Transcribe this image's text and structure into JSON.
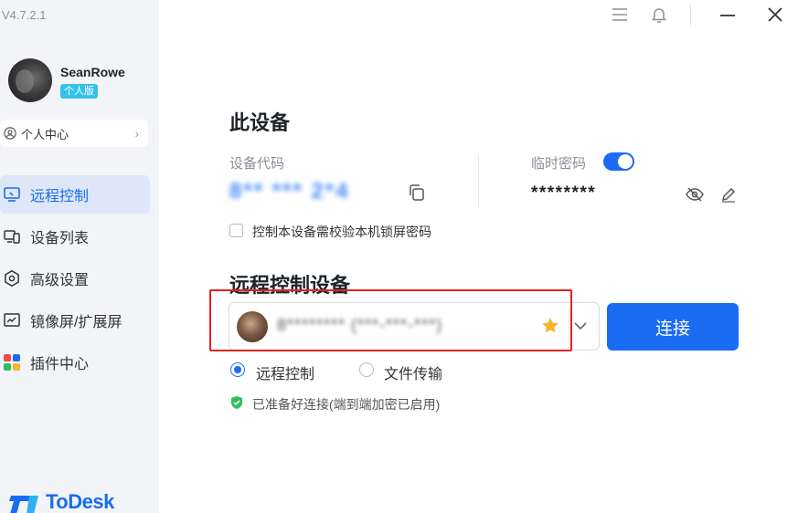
{
  "app": {
    "version": "V4.7.2.1",
    "brand_name": "ToDesk",
    "accent_color": "#1a6cf2",
    "highlight_color": "#e32222"
  },
  "user": {
    "name": "SeanRowe",
    "badge": "个人版",
    "profile_link": "个人中心"
  },
  "sidebar": {
    "items": [
      {
        "label": "远程控制",
        "icon": "monitor-icon",
        "active": true
      },
      {
        "label": "设备列表",
        "icon": "devices-icon",
        "active": false
      },
      {
        "label": "高级设置",
        "icon": "gear-icon",
        "active": false
      },
      {
        "label": "镜像屏/扩展屏",
        "icon": "mirror-screen-icon",
        "active": false
      },
      {
        "label": "插件中心",
        "icon": "plugins-icon",
        "active": false
      }
    ]
  },
  "titlebar": {
    "icons": [
      "menu-icon",
      "bell-icon",
      "minimize-icon",
      "close-icon"
    ]
  },
  "this_device": {
    "heading": "此设备",
    "code_label": "设备代码",
    "code_value": "8**  *** 2*4",
    "temp_password_label": "临时密码",
    "temp_password_enabled": true,
    "password_value": "********",
    "lock_checkbox_label": "控制本设备需校验本机锁屏密码",
    "lock_checkbox_checked": false
  },
  "remote": {
    "heading": "远程控制设备",
    "device_value": "8******** (***-***-***)",
    "favorite": true,
    "connect_label": "连接",
    "modes": [
      {
        "label": "远程控制",
        "selected": true
      },
      {
        "label": "文件传输",
        "selected": false
      }
    ],
    "status": "已准备好连接(端到端加密已启用)"
  }
}
